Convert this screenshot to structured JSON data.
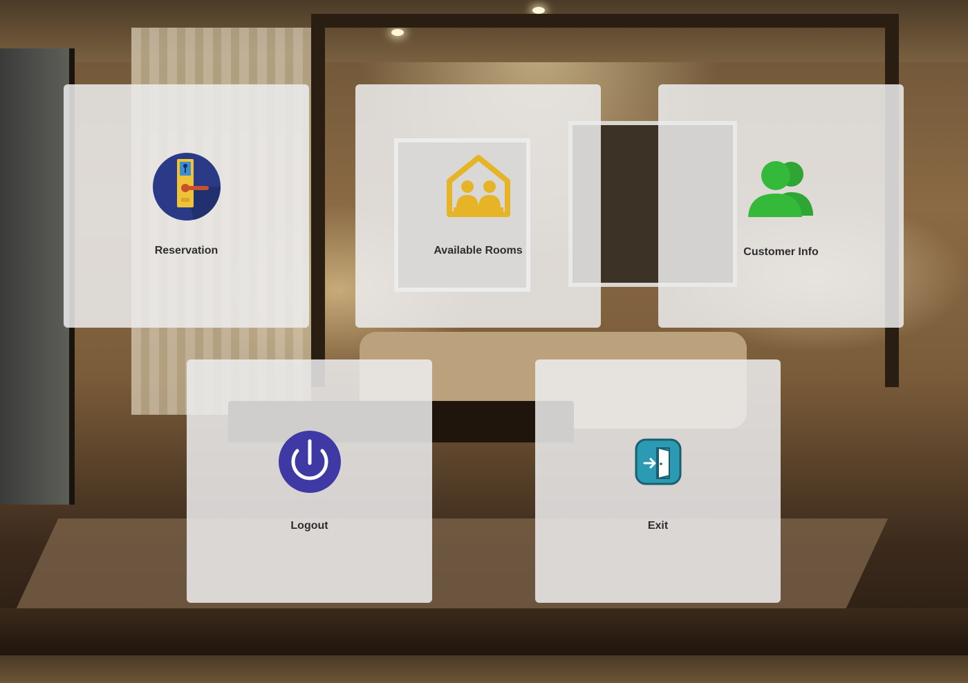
{
  "tiles": [
    {
      "label": "Reservation",
      "icon": "hotel-key-card-icon",
      "icon_bg": "#2b3a86",
      "icon_accent": "#f0c23a"
    },
    {
      "label": "Available Rooms",
      "icon": "room-occupancy-icon",
      "icon_accent": "#e6b527"
    },
    {
      "label": "Customer Info",
      "icon": "users-icon",
      "icon_accent": "#35b93a"
    },
    {
      "label": "Logout",
      "icon": "power-icon",
      "icon_bg": "#3e39a5"
    },
    {
      "label": "Exit",
      "icon": "exit-door-icon",
      "icon_bg": "#2d9ab3"
    }
  ]
}
